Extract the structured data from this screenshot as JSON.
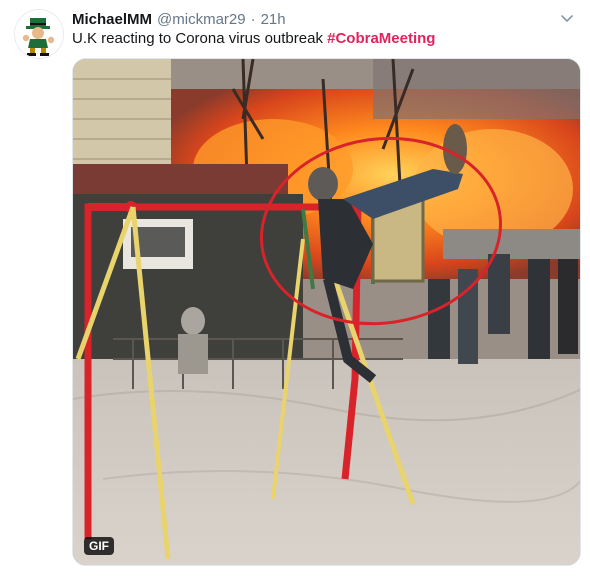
{
  "tweet": {
    "display_name": "MichaelMM",
    "handle": "@mickmar29",
    "separator": "·",
    "timestamp": "21h",
    "text": "U.K reacting to Corona virus outbreak ",
    "hashtag": "#CobraMeeting",
    "hashtag_color": "#e0245e",
    "media_badge": "GIF",
    "avatar_icon": "leprechaun-mascot-icon",
    "menu_icon": "chevron-down-icon"
  }
}
